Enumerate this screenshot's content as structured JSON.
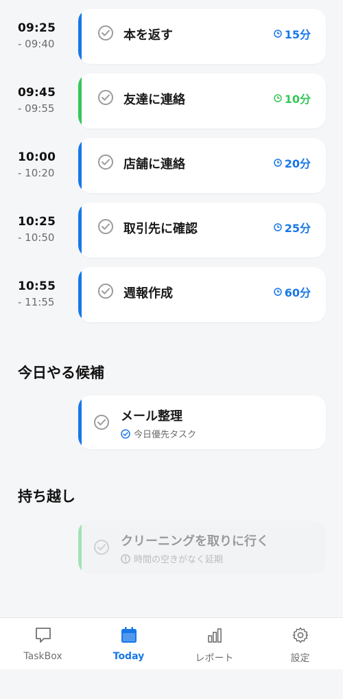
{
  "colors": {
    "blue": "#1877e8",
    "green": "#34c759",
    "gray": "#9a9a9a"
  },
  "schedule": [
    {
      "start": "09:25",
      "end": "- 09:40",
      "title": "本を返す",
      "duration": "15分",
      "accent": "#1877e8"
    },
    {
      "start": "09:45",
      "end": "- 09:55",
      "title": "友達に連絡",
      "duration": "10分",
      "accent": "#34c759"
    },
    {
      "start": "10:00",
      "end": "- 10:20",
      "title": "店舗に連絡",
      "duration": "20分",
      "accent": "#1877e8"
    },
    {
      "start": "10:25",
      "end": "- 10:50",
      "title": "取引先に確認",
      "duration": "25分",
      "accent": "#1877e8"
    },
    {
      "start": "10:55",
      "end": "- 11:55",
      "title": "週報作成",
      "duration": "60分",
      "accent": "#1877e8"
    }
  ],
  "candidates": {
    "heading": "今日やる候補",
    "items": [
      {
        "title": "メール整理",
        "note": "今日優先タスク",
        "note_icon": "check-circle-icon",
        "accent": "#1877e8"
      }
    ]
  },
  "carryover": {
    "heading": "持ち越し",
    "items": [
      {
        "title": "クリーニングを取りに行く",
        "note": "時間の空きがなく延期",
        "note_icon": "info-circle-icon",
        "accent": "#34c759"
      }
    ]
  },
  "tabs": [
    {
      "label": "TaskBox",
      "icon": "inbox-icon",
      "active": false
    },
    {
      "label": "Today",
      "icon": "calendar-icon",
      "active": true
    },
    {
      "label": "レポート",
      "icon": "bar-chart-icon",
      "active": false
    },
    {
      "label": "設定",
      "icon": "gear-icon",
      "active": false
    }
  ]
}
